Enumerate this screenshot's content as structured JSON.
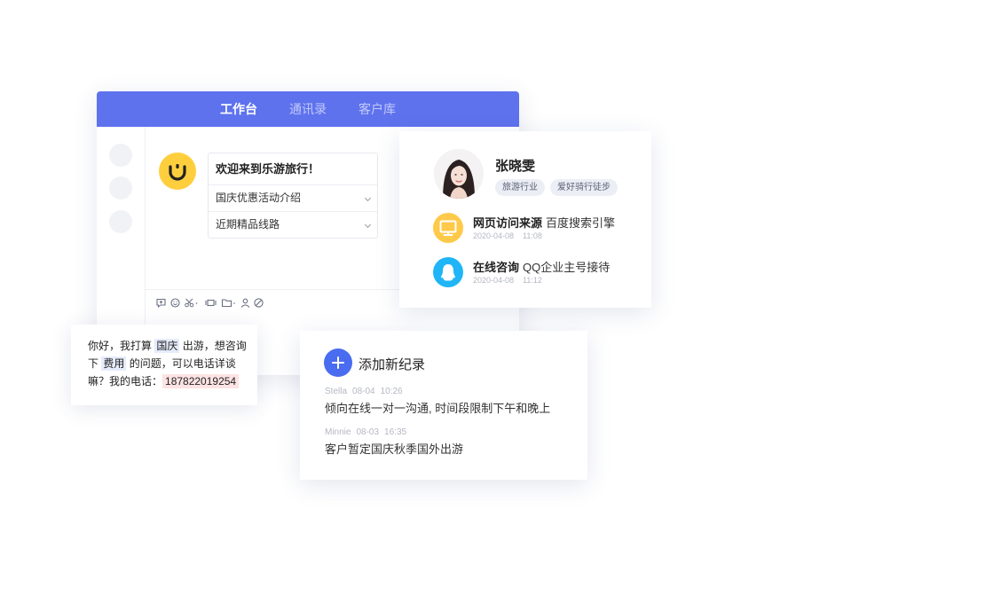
{
  "colors": {
    "brand": "#5e72ee",
    "accent": "#4a6cf0",
    "logo_yellow": "#ffce3d",
    "qq_blue": "#20b5f6"
  },
  "app": {
    "tabs": [
      {
        "label": "工作台",
        "active": true
      },
      {
        "label": "通讯录",
        "active": false
      },
      {
        "label": "客户库",
        "active": false
      }
    ],
    "welcome": {
      "title": "欢迎来到乐游旅行！",
      "items": [
        "国庆优惠活动介绍",
        "近期精品线路"
      ]
    },
    "toolbar_icons": [
      "comment-icon",
      "emoji-icon",
      "scissors-icon",
      "video-icon",
      "folder-icon",
      "contact-icon",
      "block-icon"
    ]
  },
  "customer": {
    "name": "张晓雯",
    "tags": [
      "旅游行业",
      "爱好骑行徒步"
    ],
    "rows": [
      {
        "icon": "monitor-icon",
        "title": "网页访问来源",
        "value": "百度搜索引擎",
        "date": "2020-04-08",
        "time": "11:08"
      },
      {
        "icon": "qq-icon",
        "title": "在线咨询",
        "value": "QQ企业主号接待",
        "date": "2020-04-08",
        "time": "11:12"
      }
    ]
  },
  "message": {
    "part1": "你好，我打算",
    "highlight1": "国庆",
    "part2": "出游，想咨询下",
    "highlight2": "费用",
    "part3": "的问题，可以电话详谈嘛？我的电话：",
    "phone": "187822019254"
  },
  "records": {
    "add_label": "添加新纪录",
    "items": [
      {
        "author": "Stella",
        "date": "08-04",
        "time": "10:26",
        "text": "倾向在线一对一沟通, 时间段限制下午和晚上"
      },
      {
        "author": "Minnie",
        "date": "08-03",
        "time": "16:35",
        "text": "客户暂定国庆秋季国外出游"
      }
    ]
  }
}
